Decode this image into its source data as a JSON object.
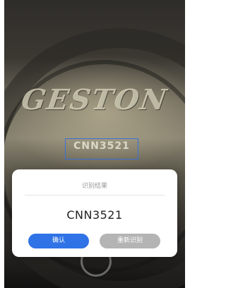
{
  "camera": {
    "brand_text": "GESTON",
    "scan_text": "CNN3521"
  },
  "dialog": {
    "title": "识别结果",
    "result": "CNN3521",
    "confirm_label": "确认",
    "retry_label": "重新识别"
  },
  "colors": {
    "confirm_button": "#2f73e6",
    "retry_button": "#b4b4b4",
    "scan_box": "#3b6fd6"
  }
}
